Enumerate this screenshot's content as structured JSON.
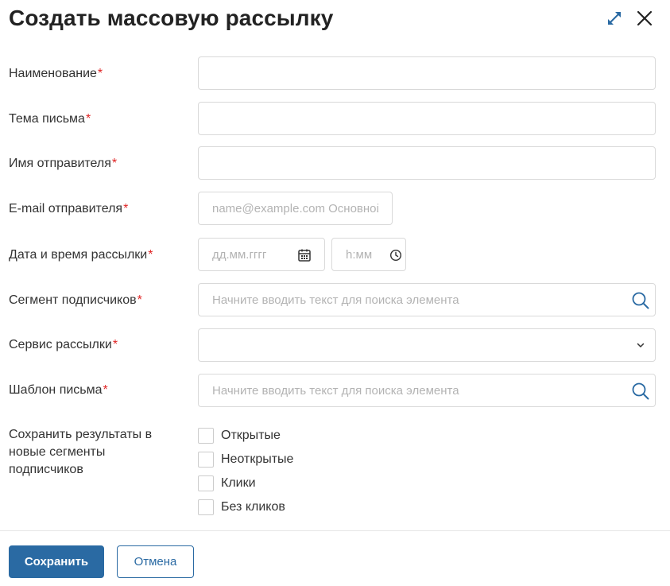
{
  "dialog": {
    "title": "Создать массовую рассылку",
    "expand_icon": "expand-arrows-icon",
    "close_icon": "close-icon"
  },
  "accent_color": "#2a6aa3",
  "required_color": "#e02424",
  "form": {
    "required_mark": "*",
    "fields": {
      "name": {
        "label": "Наименование",
        "value": ""
      },
      "subject": {
        "label": "Тема письма",
        "value": ""
      },
      "sender_name": {
        "label": "Имя отправителя",
        "value": ""
      },
      "sender_email": {
        "label": "E-mail отправителя",
        "placeholder": "name@example.com Основной"
      },
      "datetime": {
        "label": "Дата и время рассылки",
        "date_placeholder": "дд.мм.гггг",
        "time_placeholder": "h:мм"
      },
      "segment": {
        "label": "Сегмент подписчиков",
        "placeholder": "Начните вводить текст для поиска элемента"
      },
      "service": {
        "label": "Сервис рассылки",
        "value": ""
      },
      "template": {
        "label": "Шаблон письма",
        "placeholder": "Начните вводить текст для поиска элемента"
      },
      "save_results": {
        "label_lines": [
          "Сохранить результаты в",
          "новые сегменты",
          "подписчиков"
        ],
        "options": [
          "Открытые",
          "Неоткрытые",
          "Клики",
          "Без кликов"
        ]
      }
    }
  },
  "footer": {
    "save_label": "Сохранить",
    "cancel_label": "Отмена"
  }
}
